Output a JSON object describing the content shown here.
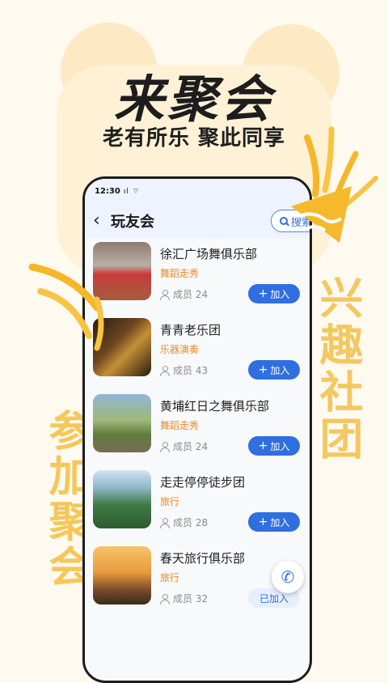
{
  "banner": {
    "headline": "来聚会",
    "subhead": "老有所乐 聚此同享",
    "left_vertical": "参加聚会",
    "right_vertical": "兴趣社团"
  },
  "statusbar": {
    "time": "12:30",
    "signal": "ıl ⌔"
  },
  "navbar": {
    "title": "玩友会",
    "search_label": "搜索"
  },
  "clubs": [
    {
      "name": "徐汇广场舞俱乐部",
      "tag": "舞蹈走秀",
      "members_label": "成员",
      "members": "24",
      "action": "加入"
    },
    {
      "name": "青青老乐团",
      "tag": "乐器演奏",
      "members_label": "成员",
      "members": "43",
      "action": "加入"
    },
    {
      "name": "黄埔红日之舞俱乐部",
      "tag": "舞蹈走秀",
      "members_label": "成员",
      "members": "24",
      "action": "加入"
    },
    {
      "name": "走走停停徒步团",
      "tag": "旅行",
      "members_label": "成员",
      "members": "28",
      "action": "加入"
    },
    {
      "name": "春天旅行俱乐部",
      "tag": "旅行",
      "members_label": "成员",
      "members": "32",
      "action": "已加入"
    }
  ],
  "icons": {
    "back": "chevron-left-icon",
    "search": "search-icon",
    "members": "user-icon",
    "call": "phone-icon"
  },
  "colors": {
    "accent": "#2f6fe0",
    "tag": "#e98a2b",
    "deco": "#f5c24a"
  }
}
